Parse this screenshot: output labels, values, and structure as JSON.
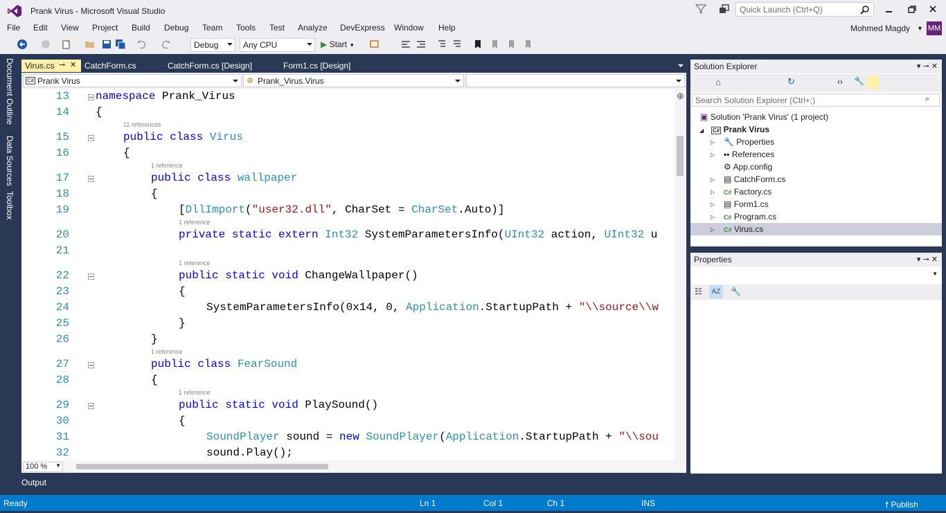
{
  "window": {
    "title": "Prank Virus - Microsoft Visual Studio",
    "quick_launch_placeholder": "Quick Launch (Ctrl+Q)",
    "user_name": "Mohmed Magdy",
    "avatar_initials": "MM"
  },
  "menus": [
    "File",
    "Edit",
    "View",
    "Project",
    "Build",
    "Debug",
    "Team",
    "Tools",
    "Test",
    "Analyze",
    "DevExpress",
    "Window",
    "Help"
  ],
  "toolbar": {
    "config": "Debug",
    "platform": "Any CPU",
    "start_label": "Start"
  },
  "left_tabs": [
    "Document Outline",
    "Data Sources",
    "Toolbox"
  ],
  "doc_tabs": [
    "Virus.cs",
    "CatchForm.cs",
    "CatchForm.cs [Design]",
    "Form1.cs [Design]"
  ],
  "nav": {
    "project": "Prank Virus",
    "type": "Prank_Virus.Virus",
    "member": ""
  },
  "code": {
    "line_numbers": [
      "13",
      "14",
      "15",
      "16",
      "17",
      "18",
      "19",
      "20",
      "21",
      "22",
      "23",
      "24",
      "25",
      "26",
      "27",
      "28",
      "29",
      "30",
      "31",
      "32"
    ],
    "refs": [
      "11 references",
      "1 reference",
      "1 reference",
      "1 reference",
      "1 reference",
      "1 reference"
    ],
    "lines": {
      "l13a": "namespace",
      "l13b": " Prank_Virus",
      "l14": "{",
      "l15a": "public class",
      "l15b": "Virus",
      "l16": "{",
      "l17a": "public class",
      "l17b": "wallpaper",
      "l18": "{",
      "l19a": "[",
      "l19b": "DllImport",
      "l19c": "(",
      "l19d": "\"user32.dll\"",
      "l19e": ", CharSet = ",
      "l19f": "CharSet",
      ".": "",
      "l19g": ".Auto)]",
      "l20a": "private static extern",
      "l20b": "Int32",
      "l20c": " SystemParametersInfo(",
      "l20d": "UInt32",
      "l20e": " action, ",
      "l20f": "UInt32",
      "l20g": " u",
      "l22a": "public static void",
      "l22b": " ChangeWallpaper()",
      "l23": "{",
      "l24a": "SystemParametersInfo(0x14, 0, ",
      "l24b": "Application",
      "l24c": ".StartupPath + ",
      "l24d": "\"\\\\source\\\\w",
      "l25": "}",
      "l26": "}",
      "l27a": "public class",
      "l27b": "FearSound",
      "l28": "{",
      "l29a": "public static void",
      "l29b": " PlaySound()",
      "l30": "{",
      "l31a": "SoundPlayer",
      "l31b": " sound = ",
      "l31c": "new",
      "l31d": "SoundPlayer",
      "l31e": "(",
      "l31f": "Application",
      "l31g": ".StartupPath + ",
      "l31h": "\"\\\\sou",
      "l32": "sound.Play();"
    }
  },
  "zoom": "100 %",
  "output_tab": "Output",
  "solution_explorer": {
    "title": "Solution Explorer",
    "search_placeholder": "Search Solution Explorer (Ctrl+;)",
    "solution": "Solution 'Prank Virus' (1 project)",
    "project": "Prank Virus",
    "items": [
      "Properties",
      "References",
      "App.config",
      "CatchForm.cs",
      "Factory.cs",
      "Form1.cs",
      "Program.cs",
      "Virus.cs"
    ]
  },
  "properties": {
    "title": "Properties"
  },
  "status": {
    "ready": "Ready",
    "ln": "Ln 1",
    "col": "Col 1",
    "ch": "Ch 1",
    "ins": "INS",
    "publish": "Publish"
  },
  "colors": {
    "accent": "#007acc",
    "vs_purple": "#68217a",
    "chrome": "#eeeef2",
    "dark": "#293955",
    "keyword": "#0000ff",
    "type": "#2b91af",
    "string": "#a31515"
  }
}
